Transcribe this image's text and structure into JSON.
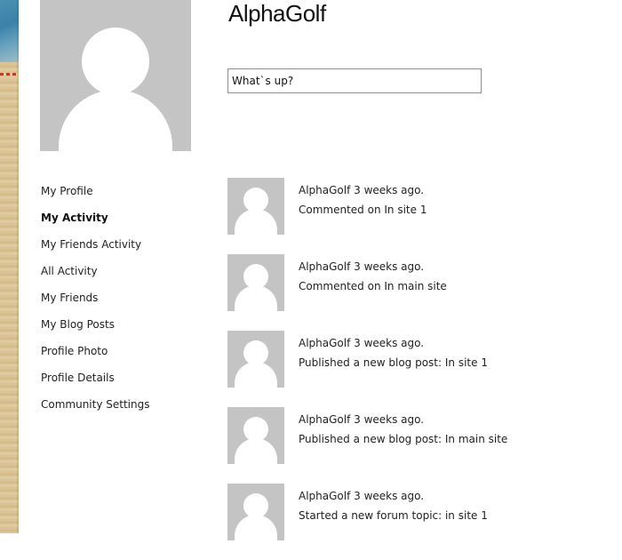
{
  "profile": {
    "name": "AlphaGolf"
  },
  "status_input": {
    "placeholder": "What`s up?"
  },
  "side_nav": {
    "items": [
      {
        "label": "My Profile"
      },
      {
        "label": "My Activity",
        "active": true
      },
      {
        "label": "My Friends Activity"
      },
      {
        "label": "All Activity"
      },
      {
        "label": "My Friends"
      },
      {
        "label": "My Blog Posts"
      },
      {
        "label": "Profile Photo"
      },
      {
        "label": "Profile Details"
      },
      {
        "label": "Community Settings"
      }
    ]
  },
  "activity": {
    "items": [
      {
        "header": "AlphaGolf 3 weeks ago.",
        "action": "Commented on In site 1"
      },
      {
        "header": "AlphaGolf 3 weeks ago.",
        "action": "Commented on In main site"
      },
      {
        "header": "AlphaGolf 3 weeks ago.",
        "action": "Published a new blog post: In site 1"
      },
      {
        "header": "AlphaGolf 3 weeks ago.",
        "action": "Published a new blog post: In main site"
      },
      {
        "header": "AlphaGolf 3 weeks ago.",
        "action": "Started a new forum topic: in site 1"
      }
    ]
  },
  "icons": {
    "profile_avatar": "user-silhouette-icon",
    "activity_avatar": "user-silhouette-icon"
  },
  "colors": {
    "avatar_bg": "#c4c4c4",
    "input_border": "#8e8e8e"
  }
}
